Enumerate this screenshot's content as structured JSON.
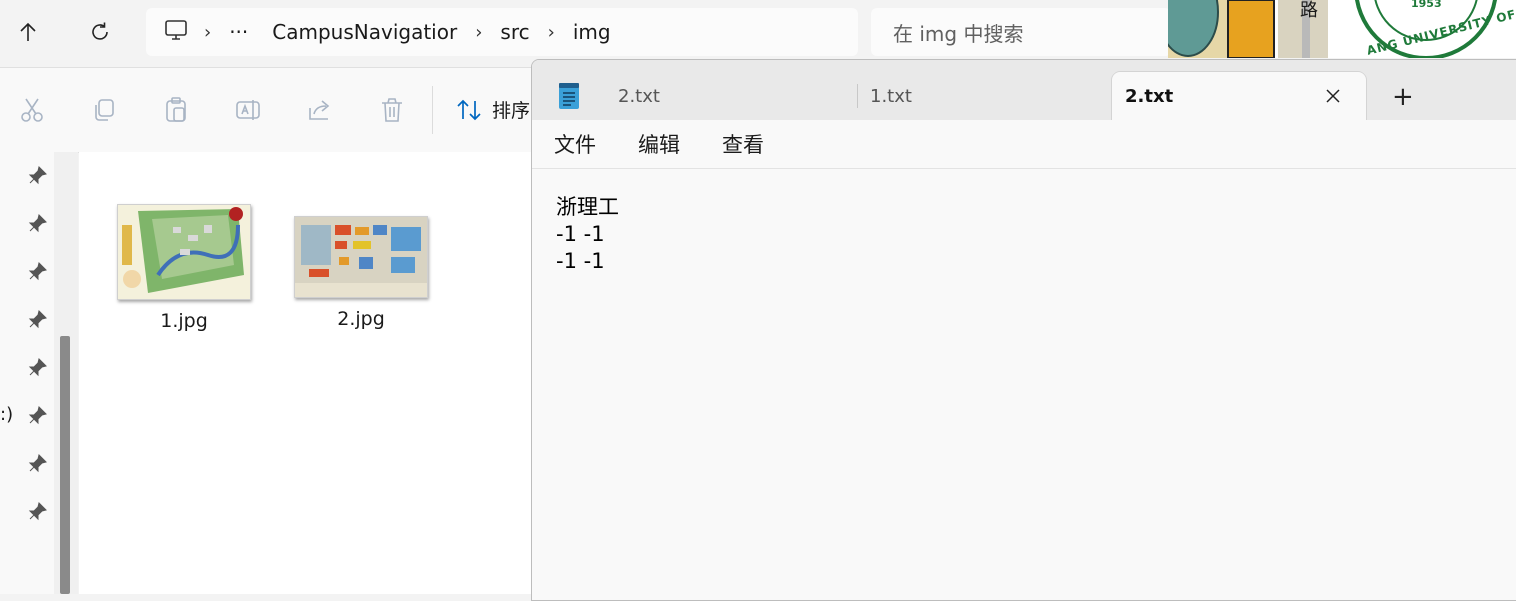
{
  "explorer": {
    "breadcrumb": {
      "ellipsis": "···",
      "items": [
        "CampusNavigatior",
        "src",
        "img"
      ]
    },
    "search": {
      "placeholder": "在 img 中搜索"
    },
    "toolbar": {
      "sort_label": "排序"
    },
    "navpane": {
      "partial_label": ":)"
    },
    "files": [
      {
        "name": "1.jpg"
      },
      {
        "name": "2.jpg"
      }
    ]
  },
  "wallpaper": {
    "partial_text": "路",
    "seal_year": "1953",
    "seal_text": "ANG UNIVERSITY OF TECH"
  },
  "notepad": {
    "tabs": [
      {
        "label": "2.txt",
        "active": false
      },
      {
        "label": "1.txt",
        "active": false
      },
      {
        "label": "2.txt",
        "active": true
      }
    ],
    "new_tab": "+",
    "menu": [
      "文件",
      "编辑",
      "查看"
    ],
    "content_lines": [
      "浙理工",
      "-1 -1",
      "-1 -1"
    ]
  },
  "colors": {
    "accent": "#0067c0",
    "notepad_icon": "#3aa0d8"
  }
}
